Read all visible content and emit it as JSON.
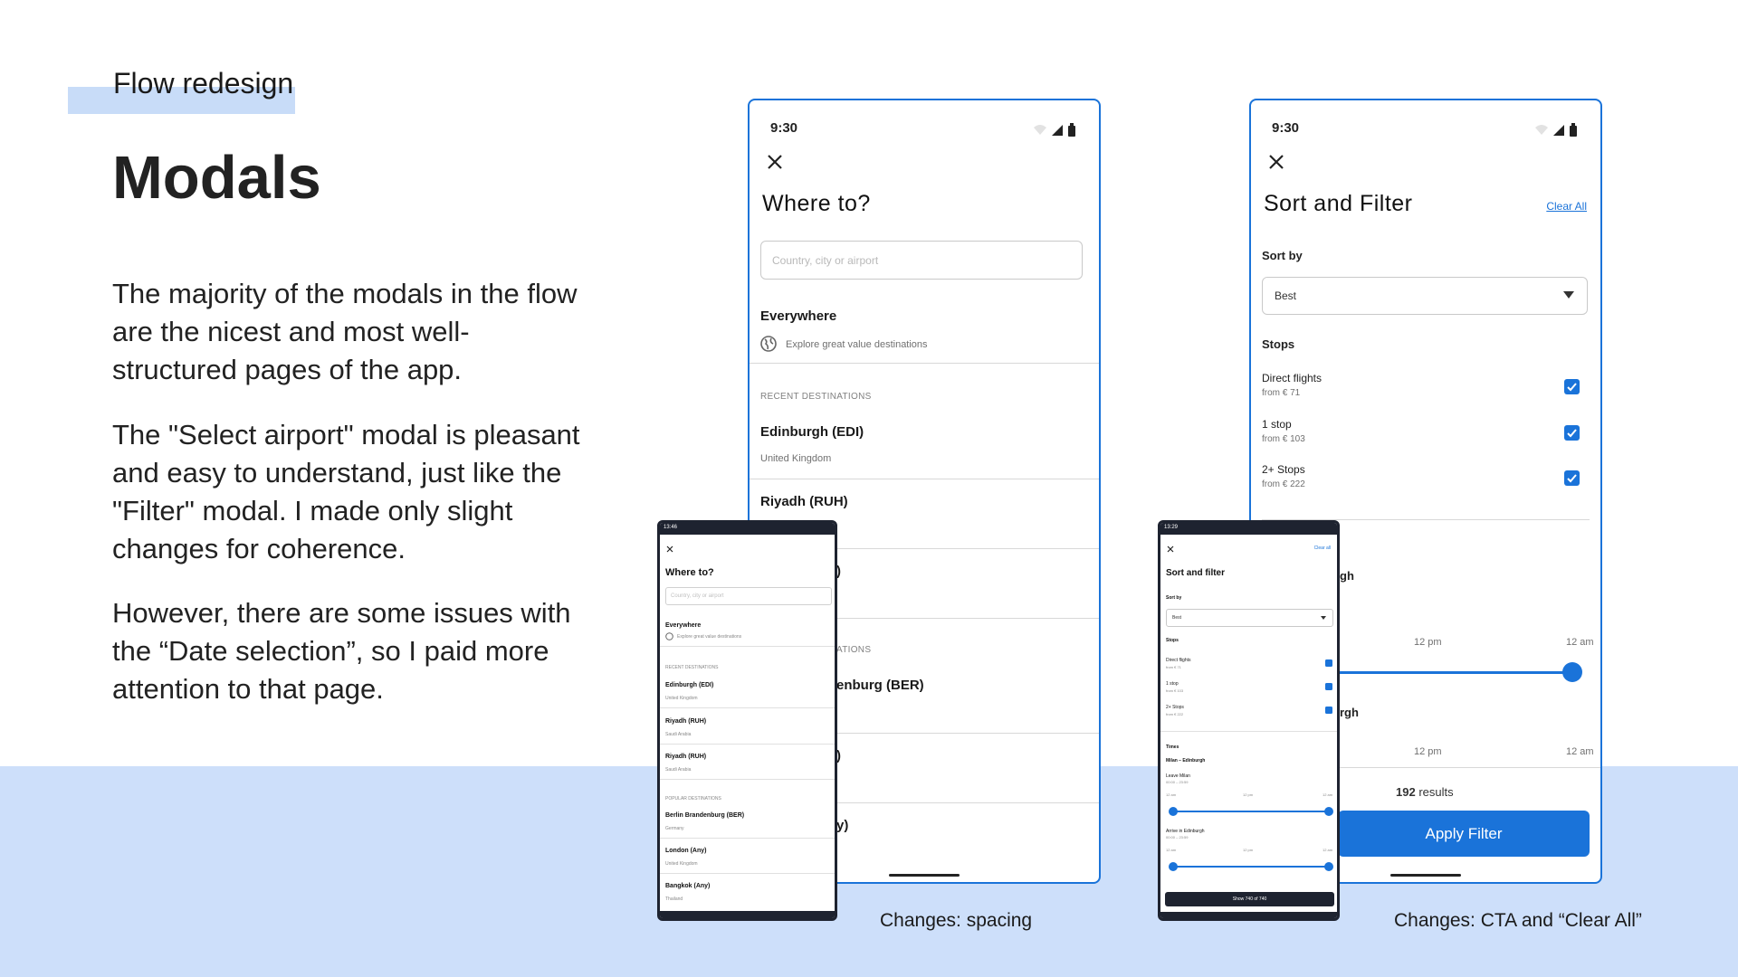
{
  "page": {
    "eyebrow": "Flow redesign",
    "title": "Modals",
    "paragraphs": [
      "The majority of the modals in the flow are the nicest and most well-structured pages of the app.",
      "The \"Select airport\" modal is pleasant and easy to understand, just like the \"Filter\" modal. I made only slight changes for coherence.",
      "However, there are some issues with the “Date selection”, so I paid more attention to that page."
    ],
    "captions": [
      "Changes: spacing",
      "Changes: CTA and “Clear All”"
    ]
  },
  "where_to_new": {
    "time": "9:30",
    "title": "Where to?",
    "search_placeholder": "Country, city or airport",
    "everywhere_title": "Everywhere",
    "everywhere_sub": "Explore great value destinations",
    "recent_label": "RECENT DESTINATIONS",
    "recent": [
      {
        "name": "Edinburgh (EDI)",
        "country": "United Kingdom"
      },
      {
        "name": "Riyadh (RUH)",
        "country": ""
      },
      {
        "name": ")",
        "country": ""
      }
    ],
    "popular_label_partial": "ATIONS",
    "popular": [
      {
        "name": "enburg (BER)"
      },
      {
        "name": ")"
      },
      {
        "name": "y)"
      }
    ]
  },
  "where_to_old": {
    "status": "13:46",
    "title": "Where to?",
    "search_placeholder": "Country, city or airport",
    "everywhere_title": "Everywhere",
    "everywhere_sub": "Explore great value destinations",
    "recent_label": "RECENT DESTINATIONS",
    "recent": [
      {
        "name": "Edinburgh (EDI)",
        "country": "United Kingdom"
      },
      {
        "name": "Riyadh (RUH)",
        "country": "Saudi Arabia"
      },
      {
        "name": "Riyadh (RUH)",
        "country": "Saudi Arabia"
      }
    ],
    "popular_label": "POPULAR DESTINATIONS",
    "popular": [
      {
        "name": "Berlin Brandenburg (BER)",
        "country": "Germany"
      },
      {
        "name": "London (Any)",
        "country": "United Kingdom"
      },
      {
        "name": "Bangkok (Any)",
        "country": "Thailand"
      }
    ]
  },
  "filter_new": {
    "time": "9:30",
    "title": "Sort and Filter",
    "clear_all": "Clear All",
    "sort_by_label": "Sort by",
    "sort_value": "Best",
    "stops_label": "Stops",
    "stops": [
      {
        "name": "Direct flights",
        "price": "from € 71",
        "checked": true
      },
      {
        "name": "1 stop",
        "price": "from € 103",
        "checked": true
      },
      {
        "name": "2+ Stops",
        "price": "from € 222",
        "checked": true
      }
    ],
    "partial_1": "gh",
    "partial_2": "rgh",
    "tick_12pm": "12 pm",
    "tick_12am": "12 am",
    "results_count": "192",
    "results_label": "results",
    "apply_label": "Apply Filter"
  },
  "filter_old": {
    "status": "13:29",
    "clear_all": "Clear all",
    "title": "Sort and filter",
    "sort_by_label": "Sort by",
    "sort_value": "Best",
    "stops_label": "Stops",
    "stops": [
      {
        "name": "Direct flights",
        "price": "from € 71"
      },
      {
        "name": "1 stop",
        "price": "from € 103"
      },
      {
        "name": "2+ Stops",
        "price": "from € 222"
      }
    ],
    "times_label": "Times",
    "route": "Milan – Edinburgh",
    "leave_label": "Leave Milan",
    "leave_range": "00:00 – 23:59",
    "arrive_label": "Arrive in Edinburgh",
    "arrive_range": "00:00 – 23:59",
    "tick_12am": "12 am",
    "tick_12pm": "12 pm",
    "button_label": "Show 740 of 740"
  },
  "colors": {
    "accent": "#1a73d9",
    "band": "#cddffa",
    "dark": "#1e2330"
  }
}
